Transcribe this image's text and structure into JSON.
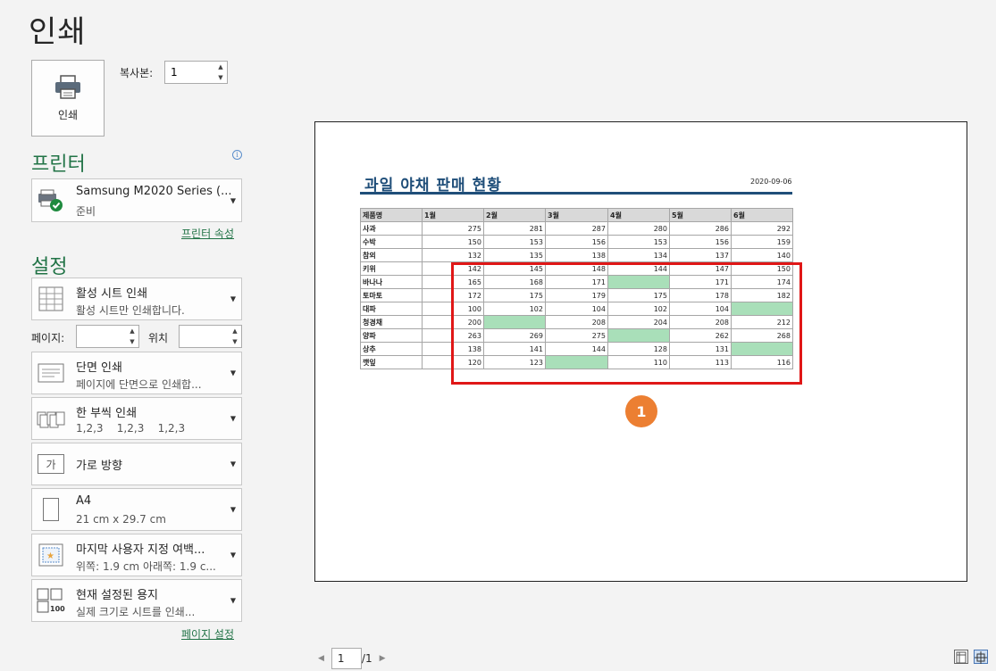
{
  "title": "인쇄",
  "print_button": {
    "label": "인쇄",
    "icon": "printer-icon"
  },
  "copies": {
    "label": "복사본:",
    "value": "1"
  },
  "printer": {
    "heading": "프린터",
    "name": "Samsung M2020 Series (...",
    "status": "준비",
    "properties_link": "프린터 속성",
    "icon": "printer-ready-icon"
  },
  "settings": {
    "heading": "설정",
    "scope": {
      "title": "활성 시트 인쇄",
      "subtitle": "활성 시트만 인쇄합니다."
    },
    "pages": {
      "label": "페이지:",
      "value": "",
      "to_label": "위치",
      "to_value": ""
    },
    "sides": {
      "title": "단면 인쇄",
      "subtitle": "페이지에 단면으로 인쇄합..."
    },
    "collate": {
      "title": "한 부씩 인쇄",
      "subtitle": "1,2,3    1,2,3    1,2,3"
    },
    "orientation": {
      "title": "가로 방향",
      "icon_text": "가"
    },
    "paper": {
      "title": "A4",
      "subtitle": "21 cm x 29.7 cm"
    },
    "margins": {
      "title": "마지막 사용자 지정 여백...",
      "subtitle": "위쪽: 1.9 cm 아래쪽: 1.9 c..."
    },
    "scaling": {
      "title": "현재 설정된 용지",
      "subtitle": "실제 크기로 시트를 인쇄...",
      "icon_text": "100"
    },
    "page_setup_link": "페이지 설정"
  },
  "preview": {
    "report_title": "과일 야채 판매 현황",
    "report_date": "2020-09-06",
    "headers": [
      "제품명",
      "1월",
      "2월",
      "3월",
      "4월",
      "5월",
      "6월"
    ],
    "rows": [
      [
        "사과",
        "275",
        "281",
        "287",
        "280",
        "286",
        "292"
      ],
      [
        "수박",
        "150",
        "153",
        "156",
        "153",
        "156",
        "159"
      ],
      [
        "참외",
        "132",
        "135",
        "138",
        "134",
        "137",
        "140"
      ],
      [
        "키위",
        "142",
        "145",
        "148",
        "144",
        "147",
        "150"
      ],
      [
        "바나나",
        "165",
        "168",
        "171",
        "",
        "171",
        "174"
      ],
      [
        "토마토",
        "172",
        "175",
        "179",
        "175",
        "178",
        "182"
      ],
      [
        "대파",
        "100",
        "102",
        "104",
        "102",
        "104",
        ""
      ],
      [
        "청경채",
        "200",
        "",
        "208",
        "204",
        "208",
        "212"
      ],
      [
        "양파",
        "263",
        "269",
        "275",
        "",
        "262",
        "268"
      ],
      [
        "상추",
        "138",
        "141",
        "144",
        "128",
        "131",
        ""
      ],
      [
        "깻잎",
        "120",
        "123",
        "",
        "110",
        "113",
        "116"
      ]
    ],
    "callout_number": "1",
    "empty_cell_color": "#a9dfb9",
    "highlight_color": "#e01717"
  },
  "pager": {
    "current": "1",
    "total": "/1"
  }
}
